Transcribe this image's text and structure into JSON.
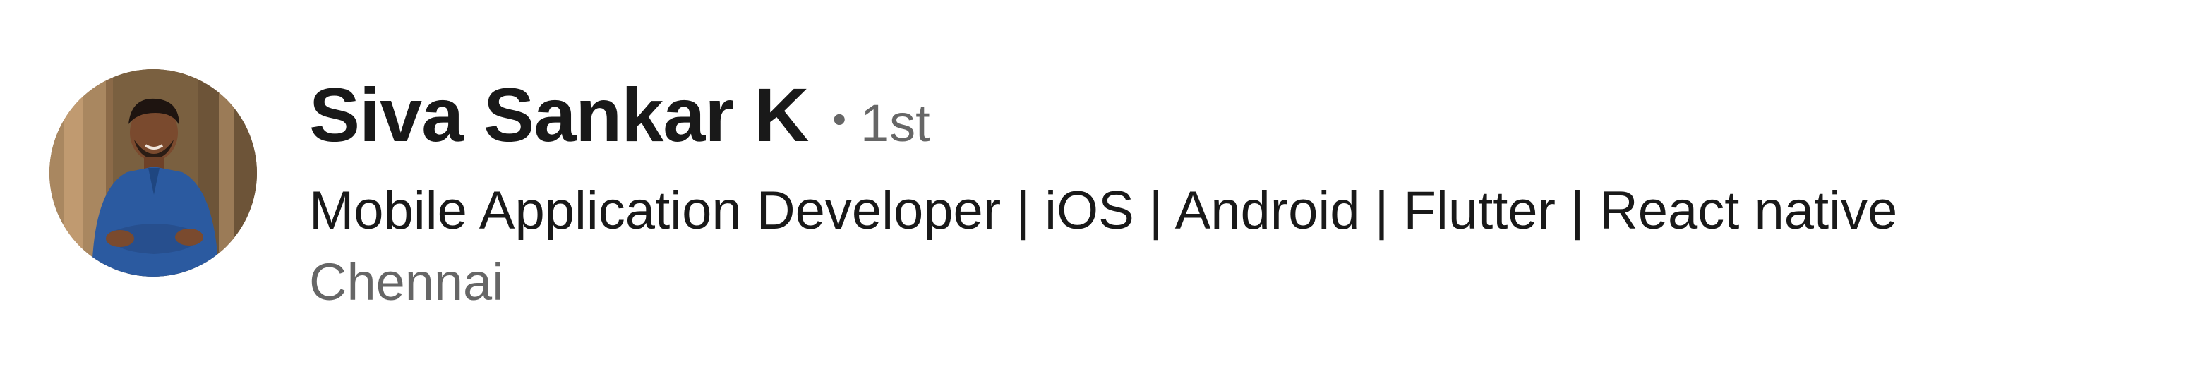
{
  "profile": {
    "name": "Siva Sankar K",
    "separator": "•",
    "connection_degree": "1st",
    "headline": "Mobile Application Developer | iOS | Android | Flutter | React native",
    "location": "Chennai"
  },
  "colors": {
    "name_text": "#191919",
    "secondary_text": "#666666",
    "background": "#ffffff"
  }
}
